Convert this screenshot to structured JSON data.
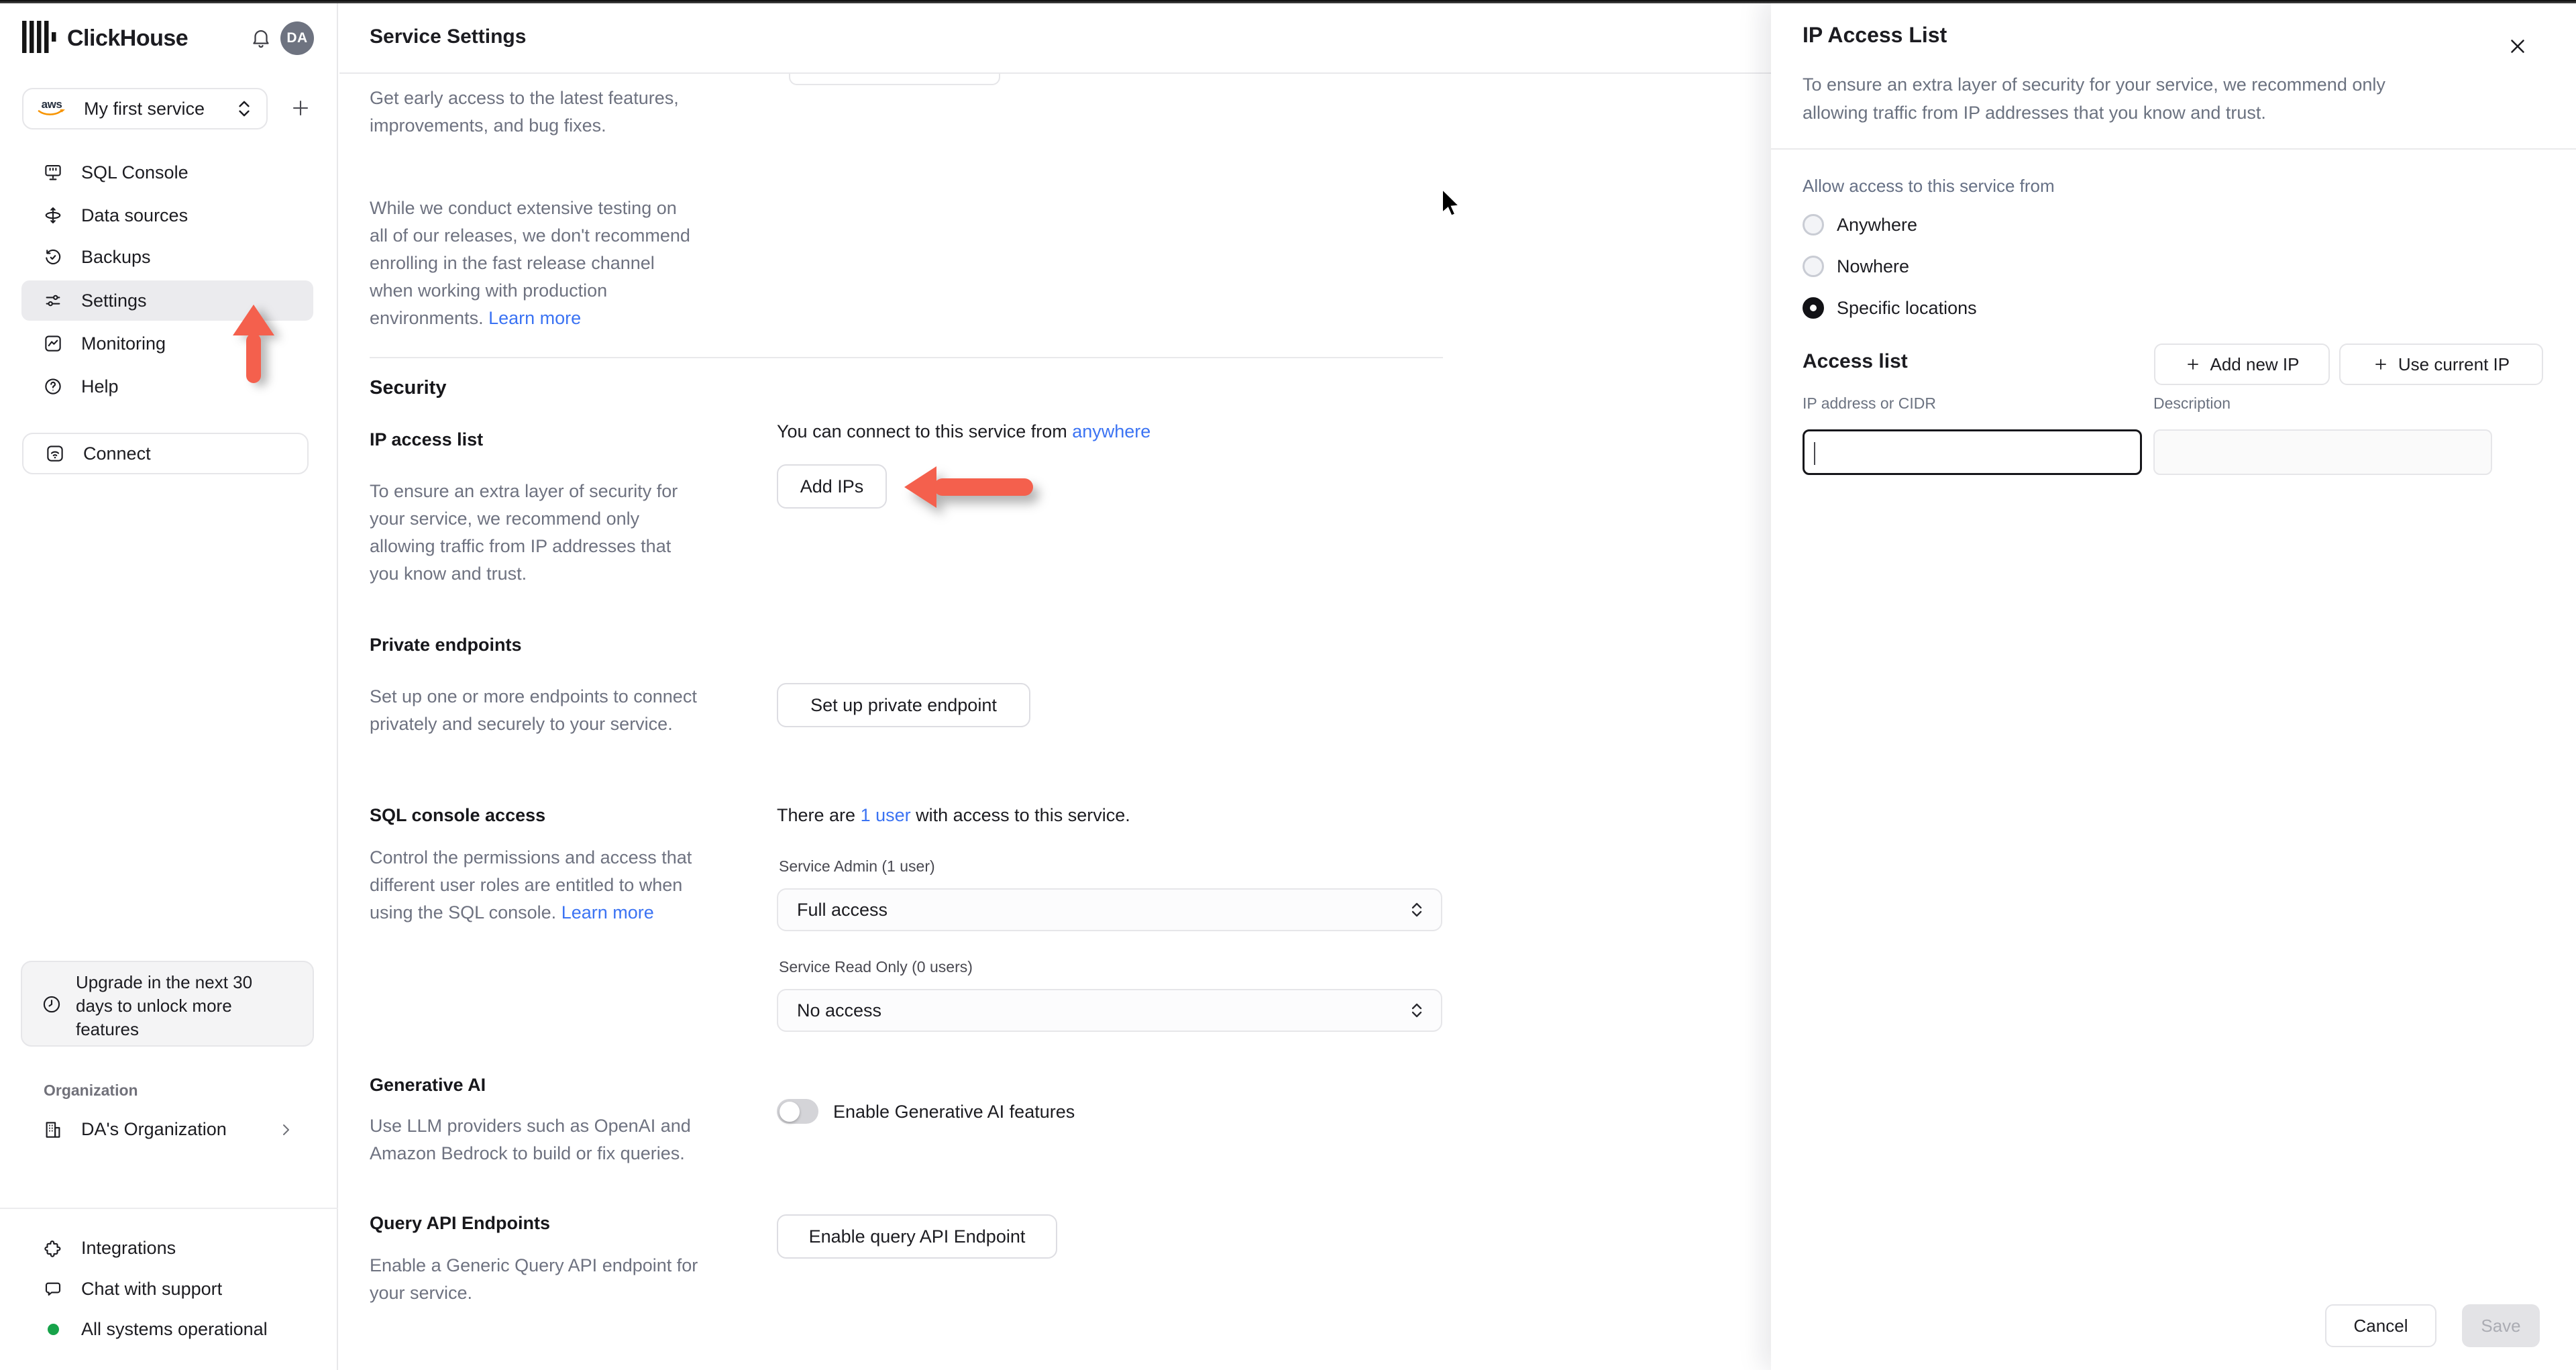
{
  "colors": {
    "link_blue": "#3b73f3",
    "arrow_red": "#f4604d",
    "status_green": "#17a34a"
  },
  "topbar": {
    "brand": "ClickHouse",
    "avatar_initials": "DA"
  },
  "sidebar": {
    "service_selector": {
      "provider": "aws",
      "label": "My first service"
    },
    "nav": [
      {
        "label": "SQL Console"
      },
      {
        "label": "Data sources"
      },
      {
        "label": "Backups"
      },
      {
        "label": "Settings"
      },
      {
        "label": "Monitoring"
      },
      {
        "label": "Help"
      }
    ],
    "connect_label": "Connect",
    "upgrade_notice": "Upgrade in the next 30\ndays to unlock more\nfeatures",
    "organization_section_label": "Organization",
    "organization_name": "DA's Organization",
    "footer": {
      "integrations": "Integrations",
      "chat": "Chat with support",
      "status": "All systems operational"
    }
  },
  "main": {
    "header_title": "Service Settings",
    "release_channel": {
      "para1": "Get early access to the latest features,\nimprovements, and bug fixes.",
      "para2": "While we conduct extensive testing on\nall of our releases, we don't recommend\nenrolling in the fast release channel\nwhen working with production\nenvironments. ",
      "learn_more": "Learn more"
    },
    "security": {
      "heading": "Security",
      "ip_access_list": {
        "title": "IP access list",
        "description": "To ensure an extra layer of security for\nyour service, we recommend only\nallowing traffic from IP addresses that\nyou know and trust.",
        "status_prefix": "You can connect to this service from ",
        "status_link": "anywhere",
        "add_ips_button": "Add IPs"
      },
      "private_endpoints": {
        "title": "Private endpoints",
        "description": "Set up one or more endpoints to connect\nprivately and securely to your service.",
        "button": "Set up private endpoint"
      },
      "sql_console_access": {
        "title": "SQL console access",
        "description": "Control the permissions and access that\ndifferent user roles are entitled to when\nusing the SQL console. ",
        "learn_more": "Learn more",
        "users_prefix": "There are ",
        "users_link": "1 user",
        "users_suffix": " with access to this service.",
        "service_admin_label": "Service Admin (1 user)",
        "service_admin_value": "Full access",
        "service_read_only_label": "Service Read Only (0 users)",
        "service_read_only_value": "No access"
      },
      "generative_ai": {
        "title": "Generative AI",
        "description": "Use LLM providers such as OpenAI and\nAmazon Bedrock to build or fix queries.",
        "toggle_label": "Enable Generative AI features"
      },
      "query_api_endpoints": {
        "title": "Query API Endpoints",
        "description": "Enable a Generic Query API endpoint for\nyour service.",
        "button": "Enable query API Endpoint"
      }
    }
  },
  "drawer": {
    "title": "IP Access List",
    "description": "To ensure an extra layer of security for your service, we recommend only\nallowing traffic from IP addresses that you know and trust.",
    "allow_access_label": "Allow access to this service from",
    "radio_options": [
      {
        "label": "Anywhere",
        "selected": false
      },
      {
        "label": "Nowhere",
        "selected": false
      },
      {
        "label": "Specific locations",
        "selected": true
      }
    ],
    "access_list": {
      "heading": "Access list",
      "add_new_ip_button": "Add new IP",
      "use_current_ip_button": "Use current IP",
      "ip_label": "IP address or CIDR",
      "description_label": "Description",
      "ip_value": "",
      "description_value": ""
    },
    "footer": {
      "cancel": "Cancel",
      "save": "Save"
    }
  }
}
